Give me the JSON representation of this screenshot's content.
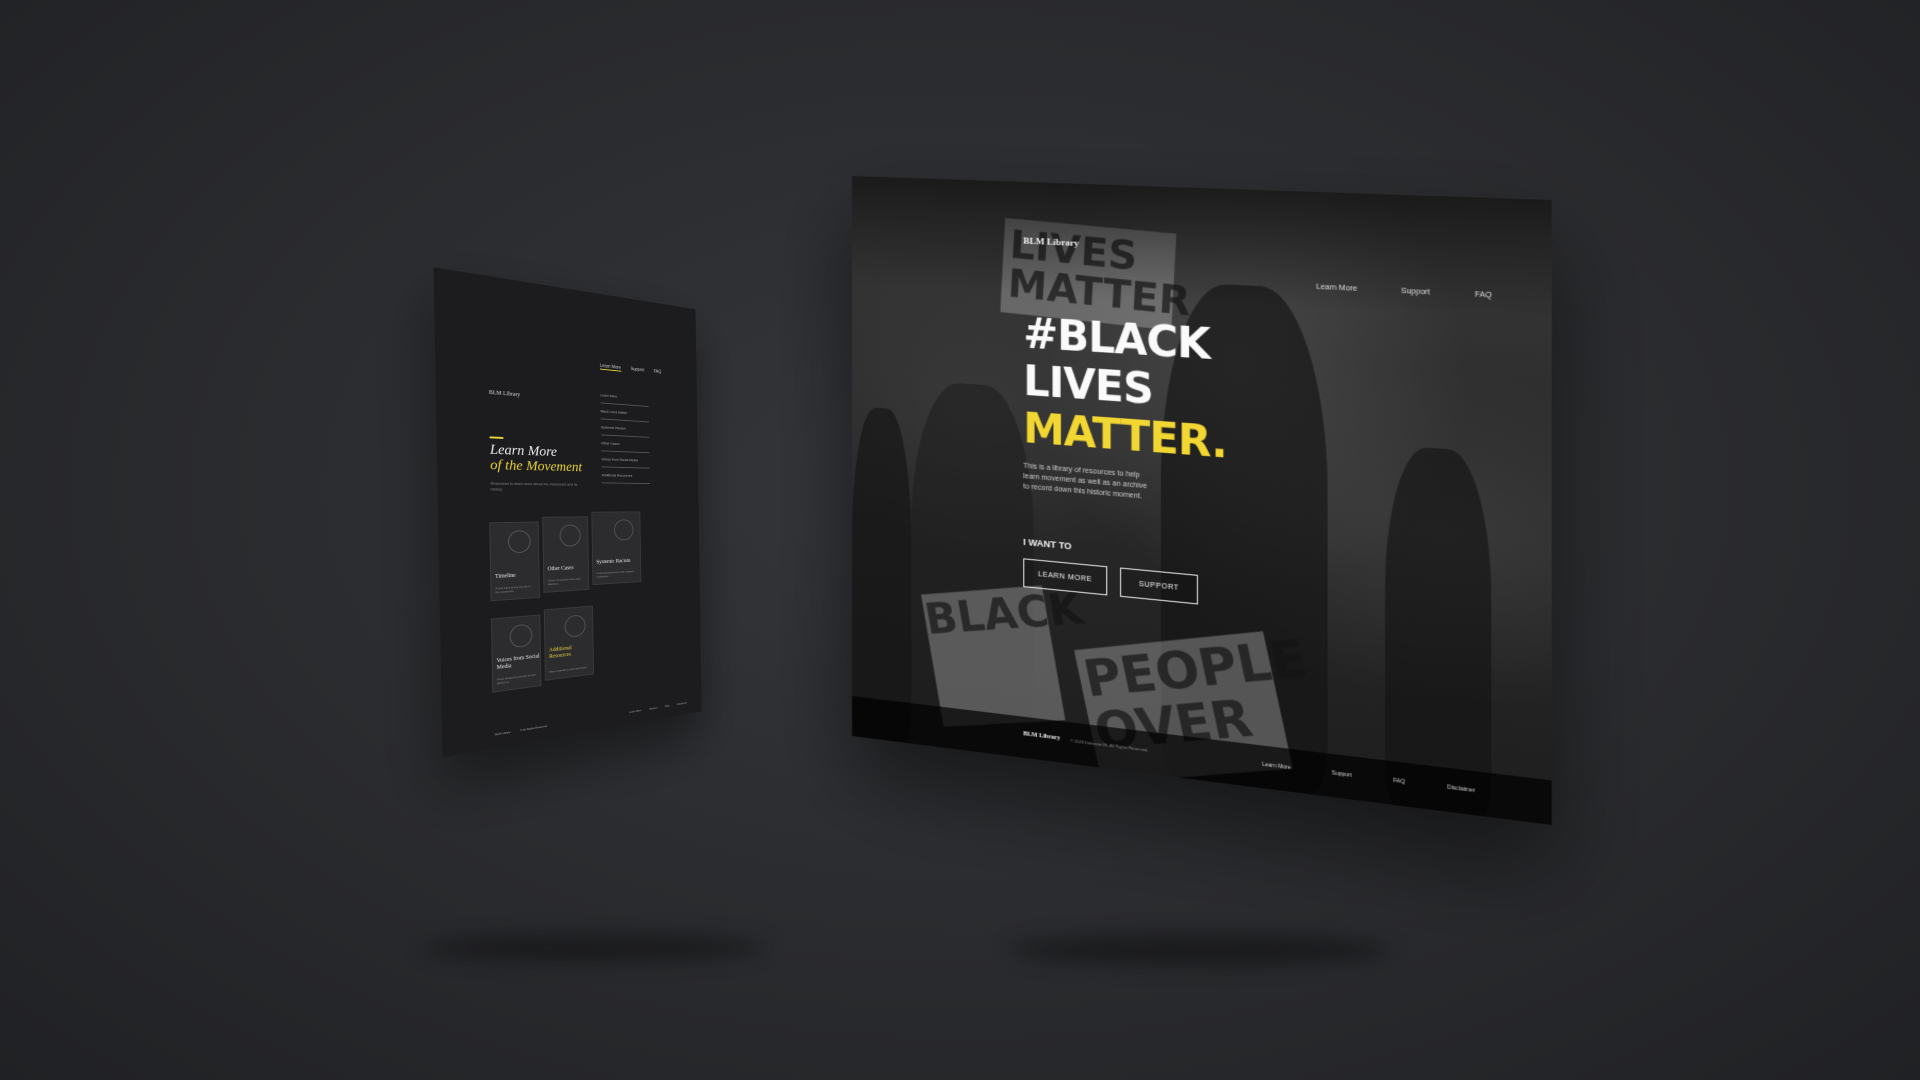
{
  "left_page": {
    "logo": "BLM Library",
    "nav": [
      "Learn More",
      "Support",
      "FAQ"
    ],
    "menu": [
      "Learn More",
      "Black Lives Matter",
      "Systemic Racism",
      "Other Cases",
      "Voices from Social Media",
      "Additional Resources"
    ],
    "title_line1": "Learn More",
    "title_line2": "of the Movement",
    "intro": "Resources to learn more about the movement and its history.",
    "cards": [
      {
        "title": "Timeline",
        "desc": "A look back at key events in the movement."
      },
      {
        "title": "Other Cases",
        "desc": "Cases of injustice that need attention."
      },
      {
        "title": "Systemic Racism",
        "desc": "Understanding how racism shapes institutions."
      },
      {
        "title": "Voices from Social Media",
        "desc": "Posts shared by people across platforms."
      },
      {
        "title": "Additional Resources",
        "desc": "More material to read and share."
      }
    ],
    "footer": {
      "logo": "BLM Library",
      "copy": "© All Rights Reserved",
      "links": [
        "Learn More",
        "Support",
        "FAQ",
        "Disclaimer"
      ]
    }
  },
  "right_page": {
    "logo": "BLM Library",
    "nav": [
      "Learn More",
      "Support",
      "FAQ"
    ],
    "headline_1": "#BLACK",
    "headline_2": "LIVES",
    "headline_3": "MATTER.",
    "description": "This is a library of resources to help learn movement as well as an archive to record down this historic moment.",
    "signs": {
      "top": "LIVES MATTER",
      "bottom_left": "BLACK",
      "bottom_right": "PEOPLE OVER"
    },
    "i_want_to": "I WANT TO",
    "buttons": {
      "learn_more": "LEARN MORE",
      "support": "SUPPORT"
    },
    "footer": {
      "logo": "BLM Library",
      "copy": "© 2020 Donovan Ni. All Rights Reserved.",
      "links": [
        "Learn More",
        "Support",
        "FAQ",
        "Disclaimer"
      ]
    }
  },
  "colors": {
    "accent": "#f2d632",
    "background": "#2a2b2e",
    "panel": "#1c1c1e"
  }
}
